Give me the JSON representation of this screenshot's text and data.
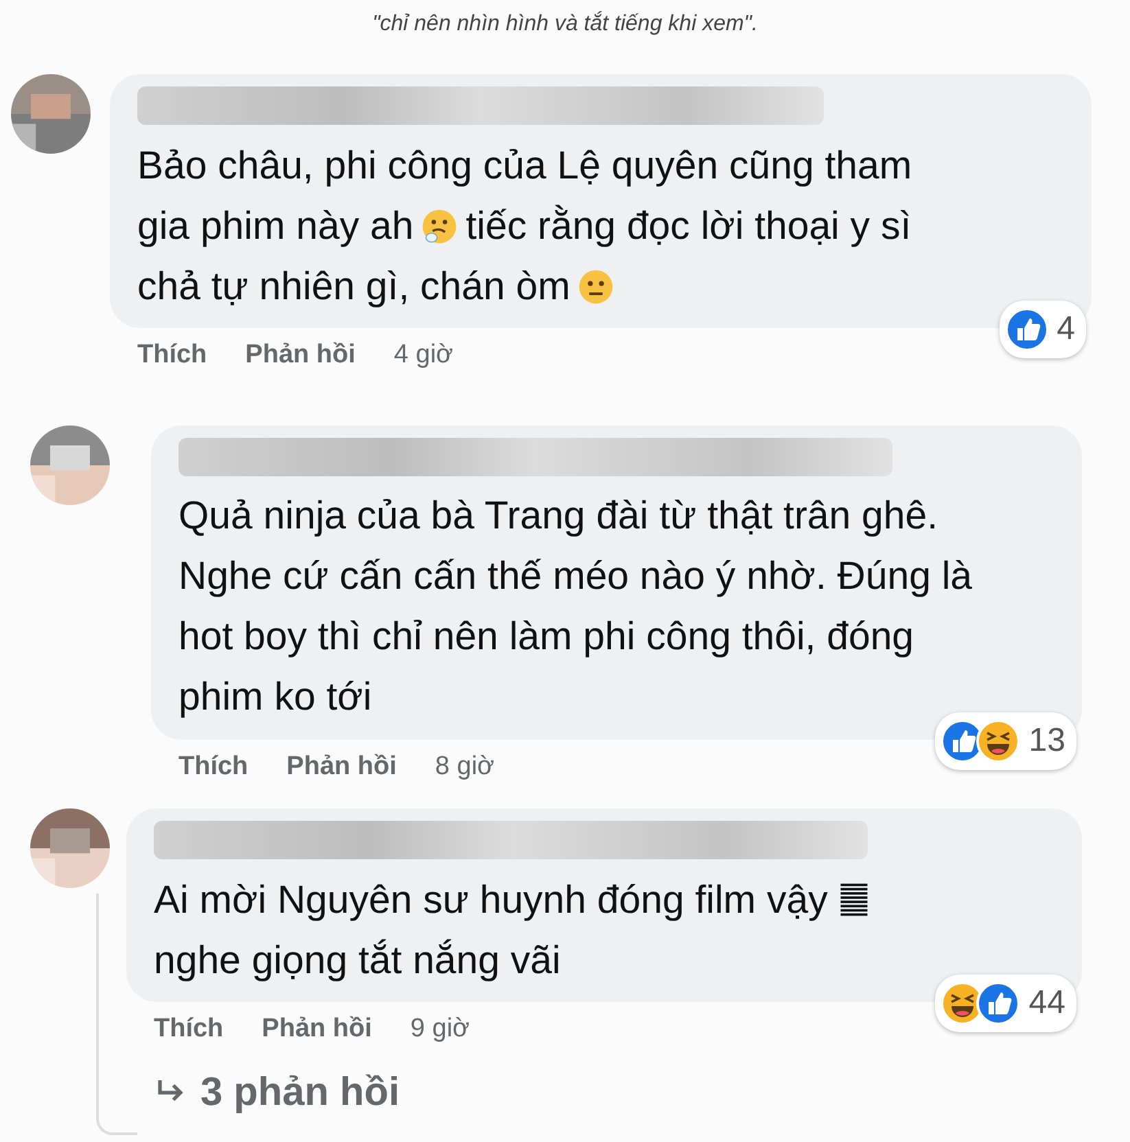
{
  "caption": "\"chỉ nên nhìn hình và tắt tiếng khi xem\".",
  "comments": [
    {
      "lines": [
        [
          {
            "kind": "text",
            "text": "Bảo châu, phi công của Lệ quyên cũng tham"
          }
        ],
        [
          {
            "kind": "text",
            "text": "gia phim này ah"
          },
          {
            "kind": "thinking"
          },
          {
            "kind": "text",
            "text": "tiếc rằng đọc lời thoại y sì"
          }
        ],
        [
          {
            "kind": "text",
            "text": "chả tự nhiên gì, chán òm"
          },
          {
            "kind": "neutral"
          }
        ]
      ],
      "reactions": [
        {
          "kind": "like"
        }
      ],
      "reaction_count": "4",
      "actions": [
        "Thích",
        "Phản hồi"
      ],
      "time": "4 giờ"
    },
    {
      "lines": [
        [
          {
            "kind": "text",
            "text": "Quả ninja của bà Trang đài từ thật trân ghê."
          }
        ],
        [
          {
            "kind": "text",
            "text": "Nghe cứ cấn cấn thế méo nào ý nhờ. Đúng là"
          }
        ],
        [
          {
            "kind": "text",
            "text": "hot boy thì chỉ nên làm phi công thôi, đóng"
          }
        ],
        [
          {
            "kind": "text",
            "text": "phim ko tới"
          }
        ]
      ],
      "reactions": [
        {
          "kind": "like"
        },
        {
          "kind": "haha"
        }
      ],
      "reaction_count": "13",
      "actions": [
        "Thích",
        "Phản hồi"
      ],
      "time": "8 giờ"
    },
    {
      "lines": [
        [
          {
            "kind": "text",
            "text": "Ai mời Nguyên sư huynh đóng film vậy"
          },
          {
            "kind": "bars"
          }
        ],
        [
          {
            "kind": "text",
            "text": "nghe giọng tắt nắng vãi"
          }
        ]
      ],
      "reactions": [
        {
          "kind": "haha"
        },
        {
          "kind": "like"
        }
      ],
      "reaction_count": "44",
      "actions": [
        "Thích",
        "Phản hồi"
      ],
      "time": "9 giờ",
      "replies": "3 phản hồi"
    }
  ]
}
